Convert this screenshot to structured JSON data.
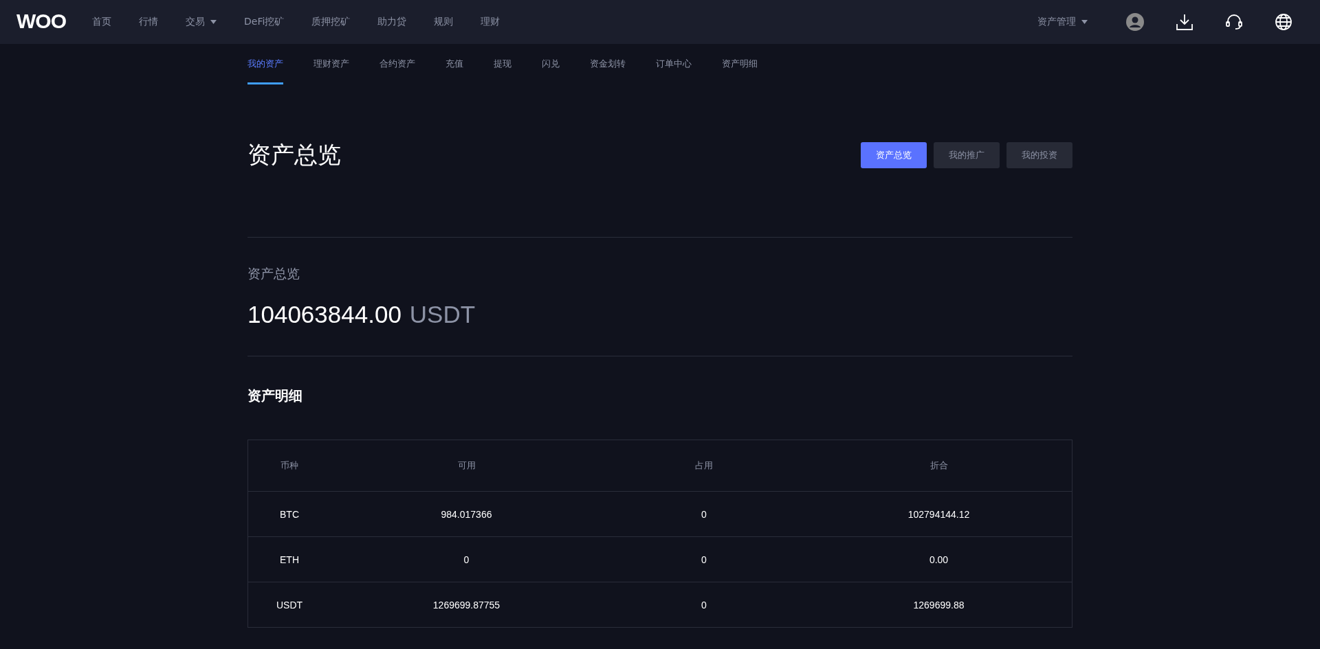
{
  "logo": {
    "text": "WOO"
  },
  "nav": [
    {
      "label": "首页",
      "dropdown": false
    },
    {
      "label": "行情",
      "dropdown": false
    },
    {
      "label": "交易",
      "dropdown": true
    },
    {
      "label": "DeFi挖矿",
      "dropdown": false
    },
    {
      "label": "质押挖矿",
      "dropdown": false
    },
    {
      "label": "助力贷",
      "dropdown": false
    },
    {
      "label": "规则",
      "dropdown": false
    },
    {
      "label": "理财",
      "dropdown": false
    }
  ],
  "asset_menu": {
    "label": "资产管理"
  },
  "subnav": [
    {
      "label": "我的资产",
      "selected": true
    },
    {
      "label": "理财资产",
      "selected": false
    },
    {
      "label": "合约资产",
      "selected": false
    },
    {
      "label": "充值",
      "selected": false
    },
    {
      "label": "提现",
      "selected": false
    },
    {
      "label": "闪兑",
      "selected": false
    },
    {
      "label": "资金划转",
      "selected": false
    },
    {
      "label": "订单中心",
      "selected": false
    },
    {
      "label": "资产明细",
      "selected": false
    }
  ],
  "page_title": "资产总览",
  "view_buttons": [
    {
      "label": "资产总览",
      "selected": true
    },
    {
      "label": "我的推广",
      "selected": false
    },
    {
      "label": "我的投资",
      "selected": false
    }
  ],
  "overview": {
    "label": "资产总览",
    "amount": "104063844.00",
    "unit": "USDT"
  },
  "details_title": "资产明细",
  "table": {
    "columns": [
      "币种",
      "可用",
      "占用",
      "折合"
    ],
    "rows": [
      [
        "BTC",
        "984.017366",
        "0",
        "102794144.12"
      ],
      [
        "ETH",
        "0",
        "0",
        "0.00"
      ],
      [
        "USDT",
        "1269699.87755",
        "0",
        "1269699.88"
      ]
    ]
  }
}
